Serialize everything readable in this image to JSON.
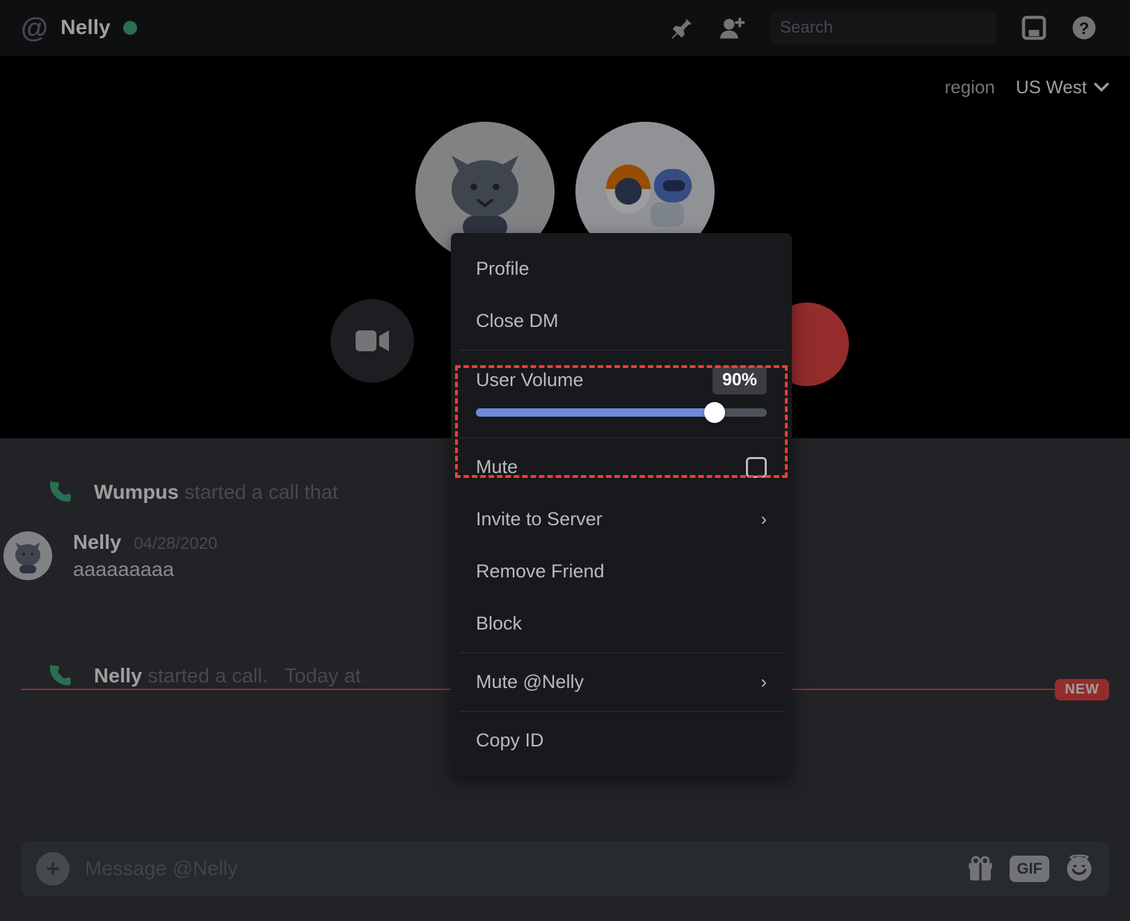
{
  "header": {
    "title": "Nelly",
    "search_placeholder": "Search"
  },
  "region": {
    "label": "region",
    "value": "US West"
  },
  "messages": {
    "call1_user": "Wumpus",
    "call1_rest": "started a call that",
    "msg_user": "Nelly",
    "msg_date": "04/28/2020",
    "msg_content": "aaaaaaaaa",
    "call2_user": "Nelly",
    "call2_rest": "started a call.",
    "call2_time": "Today at"
  },
  "divider": {
    "badge": "NEW"
  },
  "compose": {
    "placeholder": "Message @Nelly",
    "gif": "GIF"
  },
  "menu": {
    "profile": "Profile",
    "close_dm": "Close DM",
    "user_volume": "User Volume",
    "volume_value": "90%",
    "mute": "Mute",
    "invite": "Invite to Server",
    "remove": "Remove Friend",
    "block": "Block",
    "mute_user": "Mute @Nelly",
    "copy_id": "Copy ID"
  }
}
